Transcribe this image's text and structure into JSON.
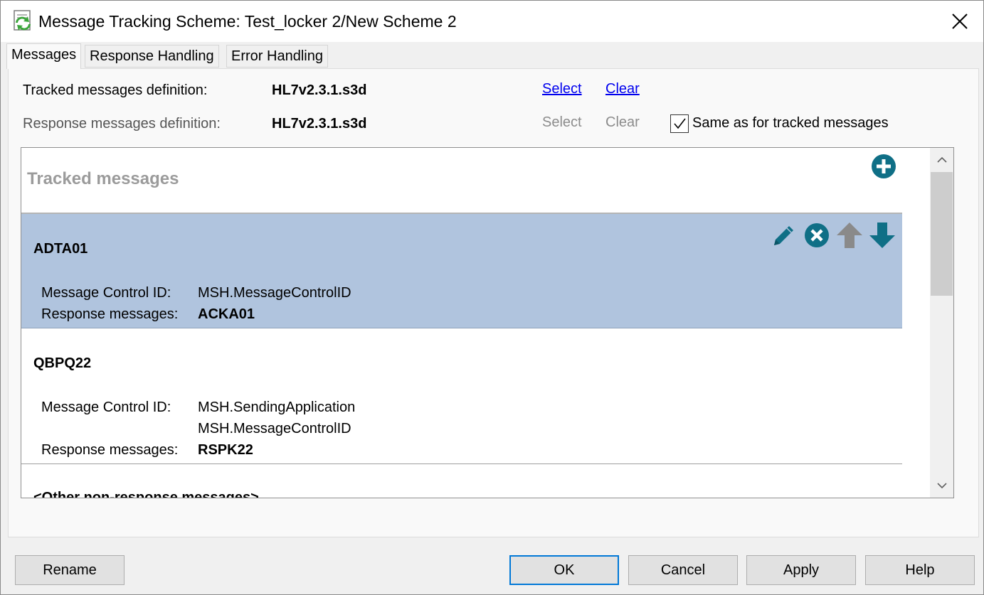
{
  "window": {
    "title": "Message Tracking Scheme: Test_locker 2/New Scheme 2",
    "close_symbol": "✕"
  },
  "tabs": [
    {
      "label": "Messages",
      "active": true
    },
    {
      "label": "Response Handling",
      "active": false
    },
    {
      "label": "Error Handling",
      "active": false
    }
  ],
  "definitions": {
    "tracked": {
      "label": "Tracked messages definition:",
      "value": "HL7v2.3.1.s3d",
      "select_label": "Select",
      "clear_label": "Clear"
    },
    "response": {
      "label": "Response messages definition:",
      "value": "HL7v2.3.1.s3d",
      "select_label": "Select",
      "clear_label": "Clear",
      "same_as_label": "Same as for tracked messages",
      "same_as_checked": true
    }
  },
  "list": {
    "header": "Tracked messages",
    "control_id_label": "Message Control ID:",
    "response_label": "Response messages:",
    "items": [
      {
        "name": "ADTA01",
        "control_ids": [
          "MSH.MessageControlID"
        ],
        "response": "ACKA01",
        "selected": true
      },
      {
        "name": "QBPQ22",
        "control_ids": [
          "MSH.SendingApplication",
          "MSH.MessageControlID"
        ],
        "response": "RSPK22",
        "selected": false
      }
    ],
    "partial_item_name": "<Other non-response messages>"
  },
  "icons": {
    "add": "plus-circle-icon",
    "edit": "pencil-icon",
    "delete": "x-circle-icon",
    "move_up": "arrow-up-icon",
    "move_down": "arrow-down-icon"
  },
  "colors": {
    "accent_teal": "#0f6f86",
    "selected_row": "#b0c4de",
    "disabled_gray": "#8c8c8c",
    "link_blue": "#0000ee"
  },
  "buttons": {
    "rename": "Rename",
    "ok": "OK",
    "cancel": "Cancel",
    "apply": "Apply",
    "help": "Help"
  }
}
